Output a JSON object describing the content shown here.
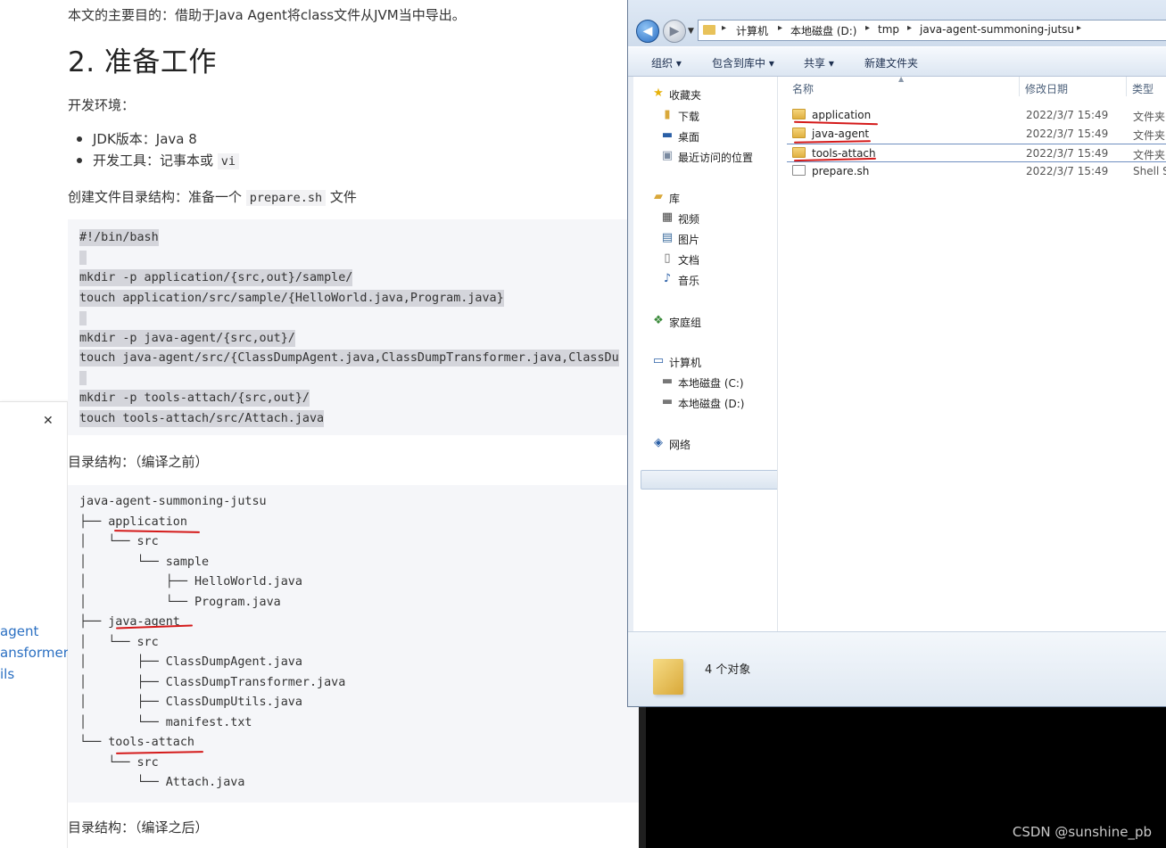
{
  "sidebar": {
    "close_icon": "close-icon",
    "items": [
      "agent",
      "ansformer",
      "ils"
    ]
  },
  "article": {
    "intro": "本文的主要目的：借助于Java Agent将class文件从JVM当中导出。",
    "heading": "2. 准备工作",
    "env_label": "开发环境：",
    "env": {
      "jdk": "JDK版本：Java 8",
      "tool_prefix": "开发工具：记事本或",
      "tool_code": "vi"
    },
    "create_prefix": "创建文件目录结构：准备一个",
    "create_code": "prepare.sh",
    "create_suffix": "文件",
    "code1": [
      "#!/bin/bash",
      "",
      "mkdir -p application/{src,out}/sample/",
      "touch application/src/sample/{HelloWorld.java,Program.java}",
      "",
      "mkdir -p java-agent/{src,out}/",
      "touch java-agent/src/{ClassDumpAgent.java,ClassDumpTransformer.java,ClassDu",
      "",
      "mkdir -p tools-attach/{src,out}/",
      "touch tools-attach/src/Attach.java"
    ],
    "before_label": "目录结构：（编译之前）",
    "tree": [
      "java-agent-summoning-jutsu",
      "├── application",
      "│   └── src",
      "│       └── sample",
      "│           ├── HelloWorld.java",
      "│           └── Program.java",
      "├── java-agent",
      "│   └── src",
      "│       ├── ClassDumpAgent.java",
      "│       ├── ClassDumpTransformer.java",
      "│       ├── ClassDumpUtils.java",
      "│       └── manifest.txt",
      "└── tools-attach",
      "    └── src",
      "        └── Attach.java"
    ],
    "after_label": "目录结构：（编译之后）"
  },
  "explorer": {
    "breadcrumbs": [
      "计算机",
      "本地磁盘 (D:)",
      "tmp",
      "java-agent-summoning-jutsu"
    ],
    "toolbar": {
      "organize": "组织 ▾",
      "include": "包含到库中 ▾",
      "share": "共享 ▾",
      "new_folder": "新建文件夹"
    },
    "nav": {
      "favorites": "收藏夹",
      "downloads": "下载",
      "desktop": "桌面",
      "recent": "最近访问的位置",
      "libraries": "库",
      "videos": "视频",
      "pictures": "图片",
      "documents": "文档",
      "music": "音乐",
      "homegroup": "家庭组",
      "computer": "计算机",
      "drive_c": "本地磁盘 (C:)",
      "drive_d": "本地磁盘 (D:)",
      "network": "网络"
    },
    "columns": {
      "name": "名称",
      "date": "修改日期",
      "type": "类型"
    },
    "files": [
      {
        "name": "application",
        "date": "2022/3/7 15:49",
        "type": "文件夹"
      },
      {
        "name": "java-agent",
        "date": "2022/3/7 15:49",
        "type": "文件夹"
      },
      {
        "name": "tools-attach",
        "date": "2022/3/7 15:49",
        "type": "文件夹"
      },
      {
        "name": "prepare.sh",
        "date": "2022/3/7 15:49",
        "type": "Shell S"
      }
    ],
    "status": "4 个对象"
  },
  "watermark": "CSDN @sunshine_pb",
  "colors": {
    "annotation_red": "#d41a1a",
    "link_blue": "#2a6fc2",
    "code_bg": "#f5f6f9",
    "terminal": "#000000"
  }
}
